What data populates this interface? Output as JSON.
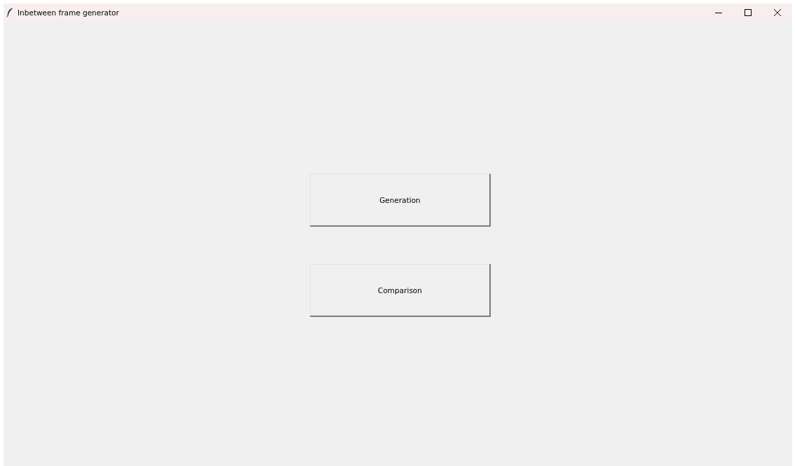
{
  "window": {
    "title": "Inbetween frame generator"
  },
  "buttons": [
    "Generation",
    "Comparison"
  ]
}
